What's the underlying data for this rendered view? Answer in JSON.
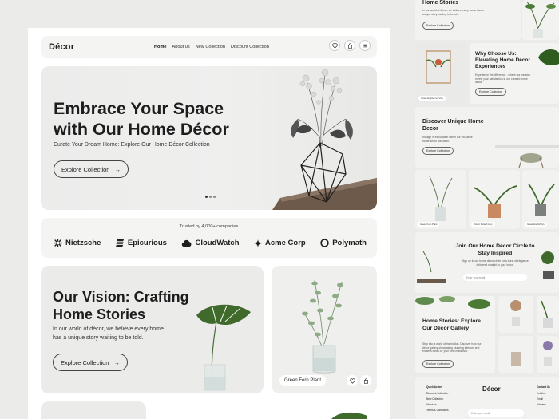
{
  "nav": {
    "logo": "Décor",
    "links": [
      "Home",
      "About us",
      "New Collection",
      "Discount Collection"
    ]
  },
  "hero": {
    "title": "Embrace Your Space with Our Home Décor",
    "subtitle": "Curate Your Dream Home: Explore Our Home Décor Collection",
    "cta": "Explore Collection"
  },
  "trusted": {
    "label": "Trusted by 4,000+ companies",
    "brands": [
      "Nietzsche",
      "Epicurious",
      "CloudWatch",
      "Acme Corp",
      "Polymath"
    ]
  },
  "vision": {
    "title": "Our Vision: Crafting Home Stories",
    "body": "In our world of décor, we believe every home has a unique story waiting to be told.",
    "cta": "Explore Collection"
  },
  "product": {
    "label": "Green Fern Plant"
  },
  "side": {
    "stories_title": "Home Stories",
    "stories_body": "In our world of décor, we believe every home has a unique story waiting to be told.",
    "stories_cta": "Explore Collection",
    "why_title": "Why Choose Us: Elevating Home Décor Experiences",
    "why_body": "Experience the difference - where our passion meets your satisfaction in our curated home décor.",
    "why_cta": "Explore Collection",
    "why_label": "Grass English Ivy Vine",
    "discover_title": "Discover Unique Home Decor",
    "discover_body": "Indulge in exploration within our exclusive home décor collection.",
    "discover_cta": "Explore Collection",
    "products": [
      "Green Fern Plant",
      "Brown Potted Ivory",
      "Grass English Ivy"
    ],
    "join_title": "Join Our Home Décor Circle to Stay Inspired",
    "join_body": "Sign up to our home décor circle for a burst of elegance delivered straight to your inbox.",
    "join_placeholder": "Enter your email",
    "gallery_title": "Home Stories: Explore Our Décor Gallery",
    "gallery_body": "Step into a world of inspiration. Discover how our décor gallery showcasing stunning interiors and endless ideas for your next makeover.",
    "gallery_cta": "Explore Collection",
    "footer_logo": "Décor",
    "footer_quick": [
      "Quick Action",
      "Discount Collection",
      "New Collection",
      "About us",
      "Terms & Conditions"
    ],
    "footer_contact": [
      "Contact Us",
      "Helpline",
      "Email",
      "Address"
    ],
    "footer_placeholder": "Enter your email"
  }
}
